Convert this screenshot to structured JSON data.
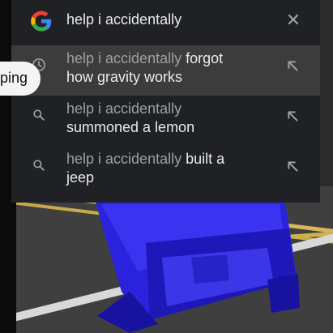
{
  "search": {
    "query": "help i accidentally",
    "clear_icon": "close-icon"
  },
  "suggestions": [
    {
      "icon": "history-icon",
      "prefix": "help i accidentally",
      "completion_line1": " forgot",
      "line2": "how gravity works",
      "line2_style": "completion"
    },
    {
      "icon": "search-icon",
      "prefix": "help i accidentally",
      "completion_line1": "",
      "line2": "summoned a lemon",
      "line2_style": "completion"
    },
    {
      "icon": "search-icon",
      "prefix": "help i accidentally",
      "completion_line1": " built a",
      "line2": "jeep",
      "line2_style": "completion"
    }
  ],
  "side_tab": {
    "label": "ping"
  },
  "colors": {
    "overlay_bg": "#202124",
    "highlight_row_bg": "#3c3c3c",
    "query_text": "#e8eaed",
    "dim_text": "#9aa0a6",
    "google_blue": "#4285F4",
    "google_red": "#EA4335",
    "google_yellow": "#FBBC05",
    "google_green": "#34A853",
    "jeep_blue": "#2b22e0"
  }
}
